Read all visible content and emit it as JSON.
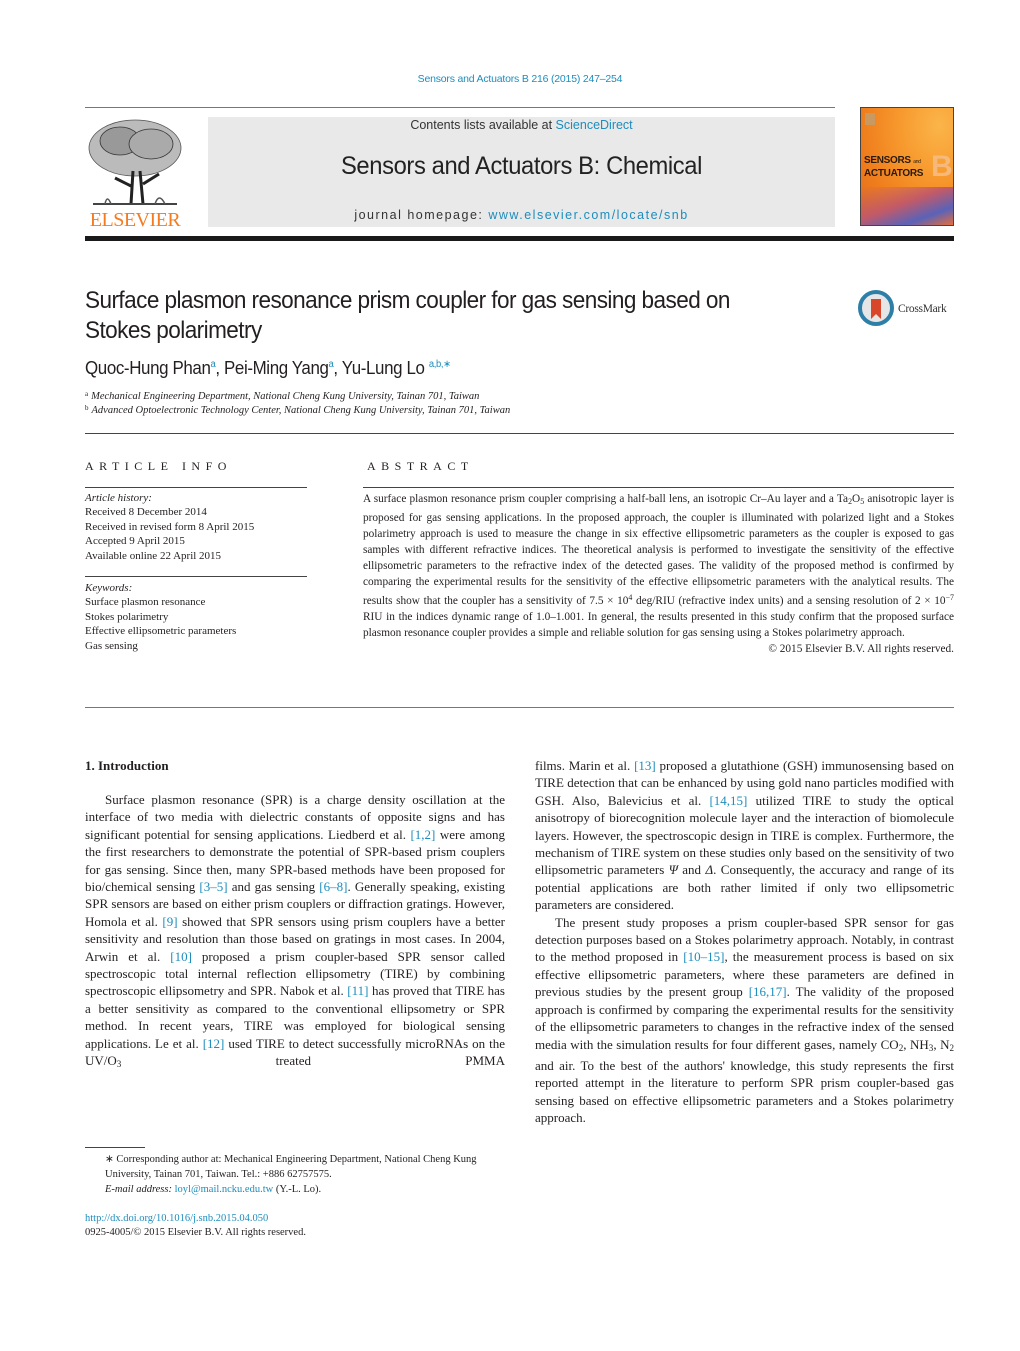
{
  "header": {
    "citation": "Sensors and Actuators B 216 (2015) 247–254",
    "contents_prefix": "Contents lists available at ",
    "contents_link": "ScienceDirect",
    "journal_title": "Sensors and Actuators B: Chemical",
    "homepage_prefix": "journal homepage: ",
    "homepage_link": "www.elsevier.com/locate/snb",
    "publisher_logo_text": "ELSEVIER",
    "cover": {
      "title_line1": "SENSORS",
      "title_and": "and",
      "title_line2": "ACTUATORS",
      "letter": "B"
    }
  },
  "article": {
    "title": "Surface plasmon resonance prism coupler for gas sensing based on Stokes polarimetry",
    "crossmark_label": "CrossMark",
    "authors": [
      {
        "name": "Quoc-Hung Phan",
        "marks": "a"
      },
      {
        "name": "Pei-Ming Yang",
        "marks": "a"
      },
      {
        "name": "Yu-Lung Lo",
        "marks": "a,b,∗"
      }
    ],
    "affiliations": [
      {
        "mark": "a",
        "text": "Mechanical Engineering Department, National Cheng Kung University, Tainan 701, Taiwan"
      },
      {
        "mark": "b",
        "text": "Advanced Optoelectronic Technology Center, National Cheng Kung University, Tainan 701, Taiwan"
      }
    ]
  },
  "article_info": {
    "heading": "ARTICLE INFO",
    "history_label": "Article history:",
    "history": [
      "Received 8 December 2014",
      "Received in revised form 8 April 2015",
      "Accepted 9 April 2015",
      "Available online 22 April 2015"
    ],
    "keywords_label": "Keywords:",
    "keywords": [
      "Surface plasmon resonance",
      "Stokes polarimetry",
      "Effective ellipsometric parameters",
      "Gas sensing"
    ]
  },
  "abstract": {
    "heading": "ABSTRACT",
    "p1_a": "A surface plasmon resonance prism coupler comprising a half-ball lens, an isotropic Cr–Au layer and a Ta",
    "p1_sub1": "2",
    "p1_b": "O",
    "p1_sub2": "5",
    "p1_c": " anisotropic layer is proposed for gas sensing applications. In the proposed approach, the coupler is illuminated with polarized light and a Stokes polarimetry approach is used to measure the change in six effective ellipsometric parameters as the coupler is exposed to gas samples with different refractive indices. The theoretical analysis is performed to investigate the sensitivity of the effective ellipsometric parameters to the refractive index of the detected gases. The validity of the proposed method is confirmed by comparing the experimental results for the sensitivity of the effective ellipsometric parameters with the analytical results. The results show that the coupler has a sensitivity of 7.5 × 10",
    "p1_sup1": "4",
    "p1_d": " deg/RIU (refractive index units) and a sensing resolution of 2 × 10",
    "p1_sup2": "−7",
    "p1_e": " RIU in the indices dynamic range of 1.0–1.001. In general, the results presented in this study confirm that the proposed surface plasmon resonance coupler provides a simple and reliable solution for gas sensing using a Stokes polarimetry approach.",
    "copyright": "© 2015 Elsevier B.V. All rights reserved."
  },
  "intro": {
    "title": "1.  Introduction",
    "p1": [
      {
        "t": "Surface plasmon resonance (SPR) is a charge density oscillation at the interface of two media with dielectric constants of opposite signs and has significant potential for sensing applications. Liedberd et al. "
      },
      {
        "ref": "[1,2]"
      },
      {
        "t": " were among the first researchers to demonstrate the potential of SPR-based prism couplers for gas sensing. Since then, many SPR-based methods have been proposed for bio/chemical sensing "
      },
      {
        "ref": "[3–5]"
      },
      {
        "t": " and gas sensing "
      },
      {
        "ref": "[6–8]"
      },
      {
        "t": ". Generally speaking, existing SPR sensors are based on either prism couplers or diffraction gratings. However, Homola et al. "
      },
      {
        "ref": "[9]"
      },
      {
        "t": " showed that SPR sensors using prism couplers have a better sensitivity and resolution than those based on gratings in most cases. In 2004, Arwin et al. "
      },
      {
        "ref": "[10]"
      },
      {
        "t": " proposed a prism coupler-based SPR sensor called spectroscopic total internal reflection ellipsometry (TIRE) by combining spectroscopic ellipsometry and SPR. Nabok et al. "
      },
      {
        "ref": "[11]"
      },
      {
        "t": " has proved that TIRE has a better sensitivity as compared to the conventional ellipsometry or SPR method. In recent years, TIRE was employed for biological sensing applications. Le et al. "
      },
      {
        "ref": "[12]"
      },
      {
        "t": " used TIRE to detect successfully microRNAs on the UV/O"
      },
      {
        "sub": "3"
      },
      {
        "t": " treated PMMA films. Marin et al. "
      },
      {
        "ref": "[13]"
      },
      {
        "t": " proposed a glutathione (GSH) immunosensing based on TIRE detection that can be enhanced by using gold nano particles modified with GSH. Also, Balevicius et al. "
      },
      {
        "ref": "[14,15]"
      },
      {
        "t": " utilized TIRE to study the optical anisotropy of biorecognition molecule layer and the interaction of biomolecule layers. However, the spectroscopic design in TIRE is complex. Furthermore, the mechanism of TIRE system on these studies only based on the sensitivity of two ellipsometric parameters "
      },
      {
        "i": "Ψ"
      },
      {
        "t": " and "
      },
      {
        "i": "Δ"
      },
      {
        "t": ". Consequently, the accuracy and range of its potential applications are both rather limited if only two ellipsometric parameters are considered."
      }
    ],
    "p2": [
      {
        "t": "The present study proposes a prism coupler-based SPR sensor for gas detection purposes based on a Stokes polarimetry approach. Notably, in contrast to the method proposed in "
      },
      {
        "ref": "[10–15]"
      },
      {
        "t": ", the measurement process is based on six effective ellipsometric parameters, where these parameters are defined in previous studies by the present group "
      },
      {
        "ref": "[16,17]"
      },
      {
        "t": ". The validity of the proposed approach is confirmed by comparing the experimental results for the sensitivity of the ellipsometric parameters to changes in the refractive index of the sensed media with the simulation results for four different gases, namely CO"
      },
      {
        "sub": "2"
      },
      {
        "t": ", NH"
      },
      {
        "sub": "3"
      },
      {
        "t": ", N"
      },
      {
        "sub": "2"
      },
      {
        "t": " and air. To the best of the authors' knowledge, this study represents the first reported attempt in the literature to perform SPR prism coupler-based gas sensing based on effective ellipsometric parameters and a Stokes polarimetry approach."
      }
    ]
  },
  "footnote": {
    "corresponding": "∗  Corresponding author at: Mechanical Engineering Department, National Cheng Kung University, Tainan 701, Taiwan. Tel.: +886 62757575.",
    "email_label": "E-mail address: ",
    "email": "loyl@mail.ncku.edu.tw",
    "email_suffix": " (Y.-L. Lo).",
    "doi": "http://dx.doi.org/10.1016/j.snb.2015.04.050",
    "issn": "0925-4005/© 2015 Elsevier B.V. All rights reserved."
  }
}
